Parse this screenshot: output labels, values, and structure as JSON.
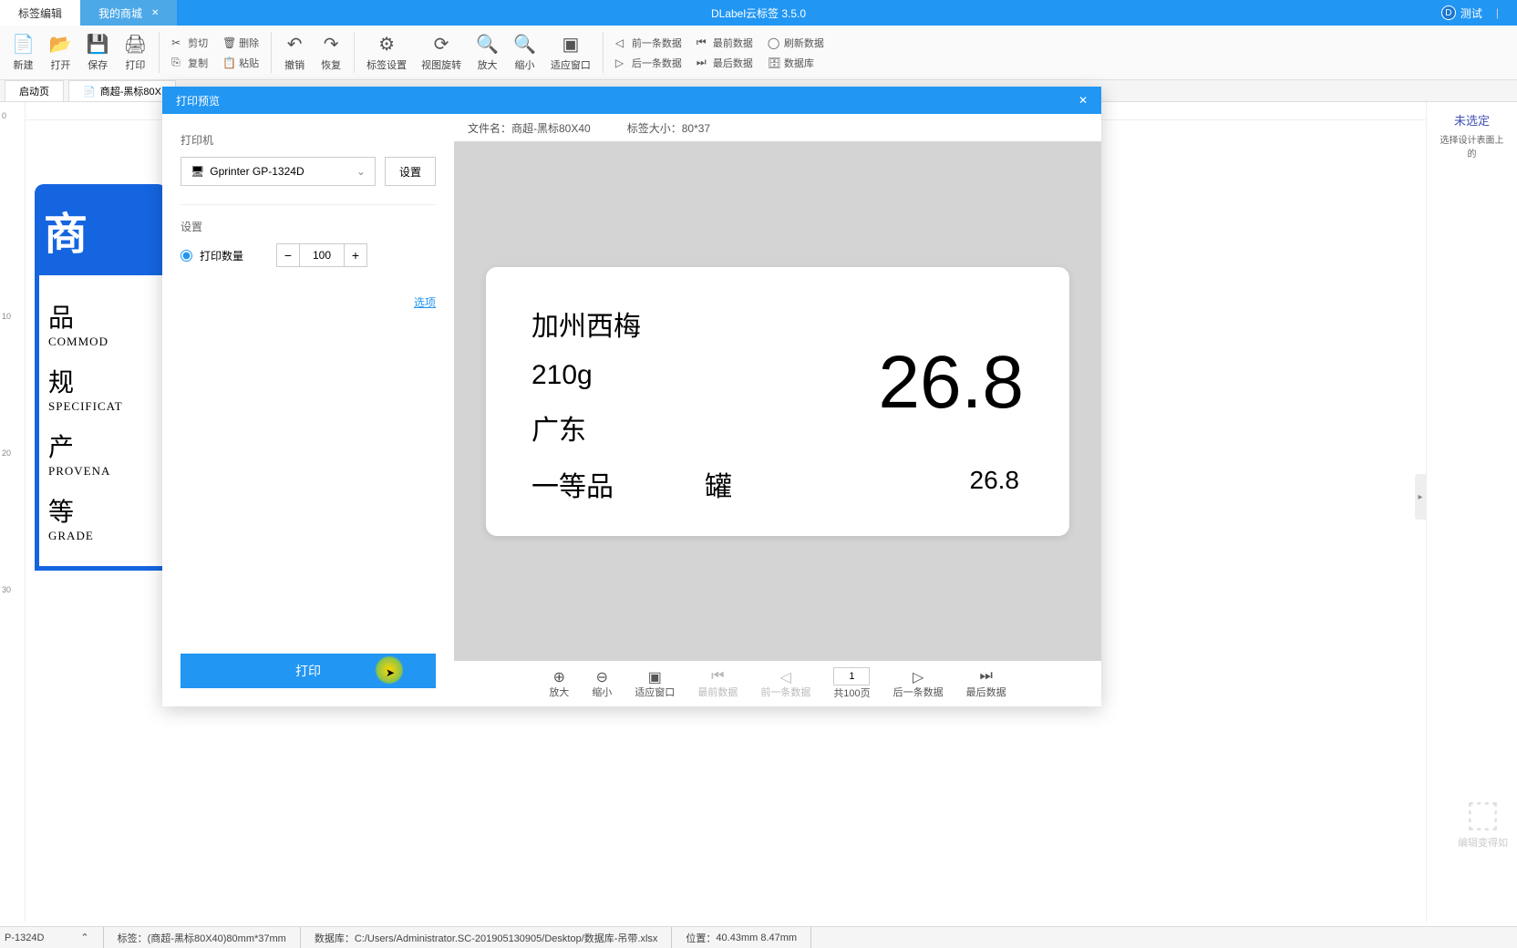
{
  "titlebar": {
    "app_title": "DLabel云标签 3.5.0",
    "test_label": "测试",
    "tabs": [
      {
        "label": "标签编辑",
        "active": true
      },
      {
        "label": "我的商城",
        "active": false
      }
    ]
  },
  "toolbar": {
    "new": "新建",
    "open": "打开",
    "save": "保存",
    "print": "打印",
    "cut": "剪切",
    "delete": "删除",
    "copy": "复制",
    "paste": "粘贴",
    "undo": "撤销",
    "redo": "恢复",
    "label_settings": "标签设置",
    "view_rotate": "视图旋转",
    "zoom_in": "放大",
    "zoom_out": "缩小",
    "fit_window": "适应窗口",
    "prev_data": "前一条数据",
    "first_data": "最前数据",
    "refresh_data": "刷新数据",
    "next_data": "后一条数据",
    "last_data": "最后数据",
    "database": "数据库"
  },
  "doc_tabs": {
    "start": "启动页",
    "doc1": "商超-黑标80X"
  },
  "ruler_ticks": [
    "0",
    "10",
    "20",
    "30"
  ],
  "canvas_label": {
    "header": "商",
    "rows": [
      {
        "cn": "品  ",
        "en": "COMMOD"
      },
      {
        "cn": "规  ",
        "en": "SPECIFICAT"
      },
      {
        "cn": "产  ",
        "en": "PROVENA"
      },
      {
        "cn": "等  ",
        "en": "GRADE"
      }
    ]
  },
  "right_panel": {
    "title": "未选定",
    "sub": "选择设计表面上的",
    "footer": "编辑变得如"
  },
  "modal": {
    "title": "打印预览",
    "printer_label": "打印机",
    "printer_value": "Gprinter GP-1324D",
    "settings_btn": "设置",
    "settings_label": "设置",
    "qty_label": "打印数量",
    "qty_value": "100",
    "options_link": "选项",
    "print_btn": "打印",
    "file_label": "文件名：",
    "file_value": "商超-黑标80X40",
    "size_label": "标签大小：",
    "size_value": "80*37"
  },
  "preview": {
    "product": "加州西梅",
    "weight": "210g",
    "origin": "广东",
    "grade": "一等品",
    "unit": "罐",
    "big_price": "26.8",
    "small_price": "26.8"
  },
  "preview_toolbar": {
    "zoom_in": "放大",
    "zoom_out": "缩小",
    "fit": "适应窗口",
    "first": "最前数据",
    "prev": "前一条数据",
    "page_num": "1",
    "total": "共100页",
    "next": "后一条数据",
    "last": "最后数据"
  },
  "statusbar": {
    "printer": "P-1324D",
    "label_prefix": "标签：",
    "label": "(商超-黑标80X40)80mm*37mm",
    "db_prefix": "数据库：",
    "db": "C:/Users/Administrator.SC-201905130905/Desktop/数据库-吊带.xlsx",
    "pos_prefix": "位置：",
    "pos": "40.43mm 8.47mm"
  }
}
